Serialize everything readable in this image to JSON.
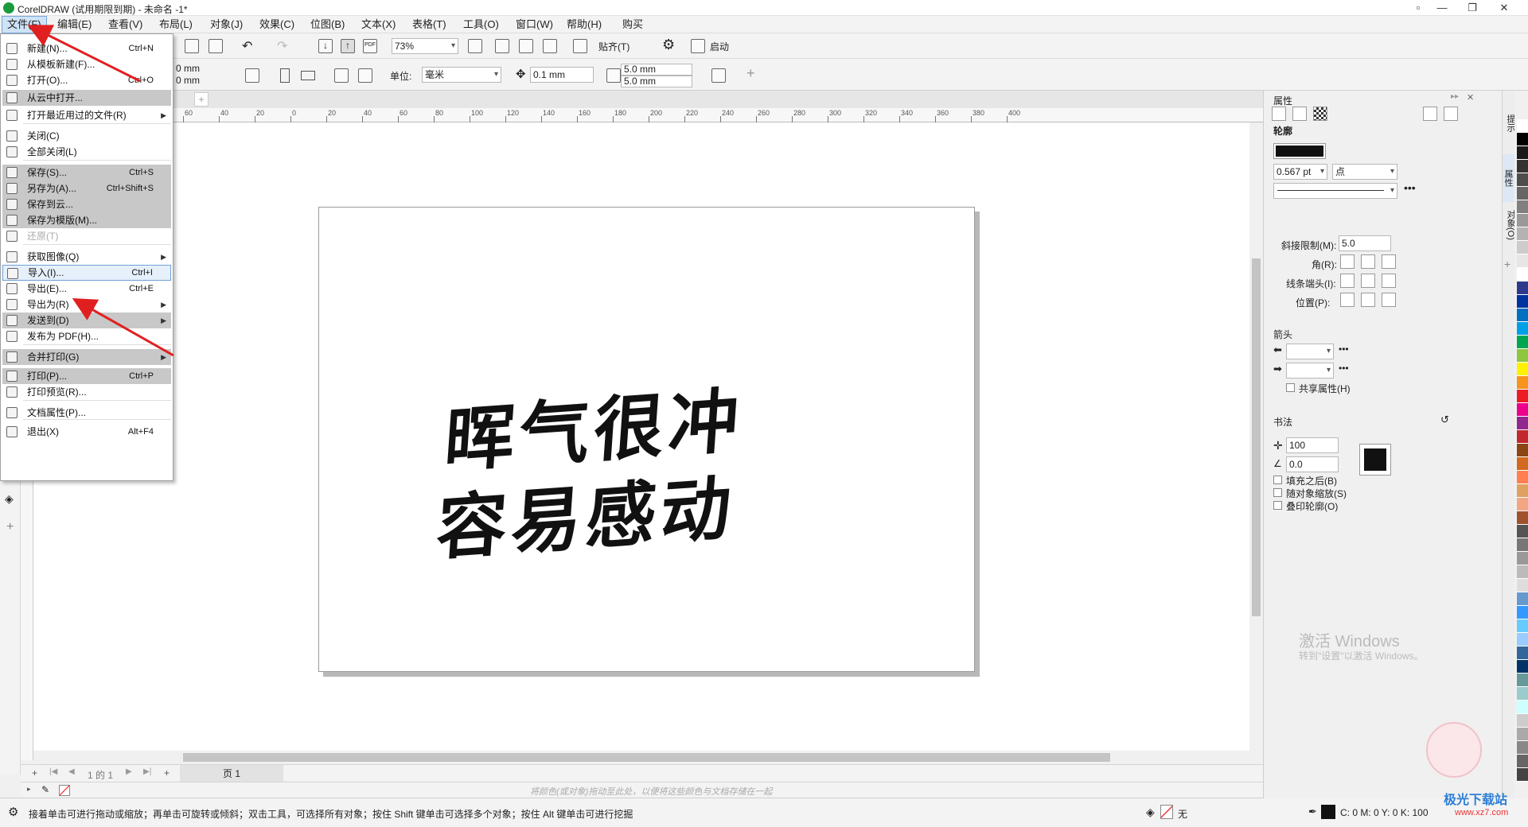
{
  "window": {
    "title": "CorelDRAW (试用期限到期) - 未命名 -1*"
  },
  "menubar": {
    "items": [
      "文件(F)",
      "编辑(E)",
      "查看(V)",
      "布局(L)",
      "对象(J)",
      "效果(C)",
      "位图(B)",
      "文本(X)",
      "表格(T)",
      "工具(O)",
      "窗口(W)",
      "帮助(H)",
      "购买"
    ]
  },
  "toolbar": {
    "zoom": "73%",
    "snap_label": "贴齐(T)",
    "launch_label": "启动",
    "pdf_label": "PDF"
  },
  "propbar": {
    "x": "0 mm",
    "y": "0 mm",
    "unit_label": "单位:",
    "unit_value": "毫米",
    "nudge": "0.1 mm",
    "dup_x": "5.0 mm",
    "dup_y": "5.0 mm"
  },
  "ruler": {
    "ticks": [
      "60",
      "40",
      "20",
      "0",
      "20",
      "40",
      "60",
      "80",
      "100",
      "120",
      "140",
      "160",
      "180",
      "200",
      "220",
      "240",
      "260",
      "280",
      "300",
      "320",
      "340",
      "360",
      "380",
      "400"
    ],
    "units": "毫米"
  },
  "file_menu": {
    "items": [
      {
        "label": "新建(N)...",
        "shortcut": "Ctrl+N"
      },
      {
        "label": "从模板新建(F)...",
        "shortcut": ""
      },
      {
        "label": "打开(O)...",
        "shortcut": "Ctrl+O"
      },
      {
        "label": "从云中打开...",
        "shortcut": ""
      },
      {
        "label": "打开最近用过的文件(R)",
        "shortcut": ""
      },
      {
        "label": "关闭(C)",
        "shortcut": ""
      },
      {
        "label": "全部关闭(L)",
        "shortcut": ""
      },
      {
        "label": "保存(S)...",
        "shortcut": "Ctrl+S"
      },
      {
        "label": "另存为(A)...",
        "shortcut": "Ctrl+Shift+S"
      },
      {
        "label": "保存到云...",
        "shortcut": ""
      },
      {
        "label": "保存为模版(M)...",
        "shortcut": ""
      },
      {
        "label": "还原(T)",
        "shortcut": ""
      },
      {
        "label": "获取图像(Q)",
        "shortcut": ""
      },
      {
        "label": "导入(I)...",
        "shortcut": "Ctrl+I"
      },
      {
        "label": "导出(E)...",
        "shortcut": "Ctrl+E"
      },
      {
        "label": "导出为(R)",
        "shortcut": ""
      },
      {
        "label": "发送到(D)",
        "shortcut": ""
      },
      {
        "label": "发布为 PDF(H)...",
        "shortcut": ""
      },
      {
        "label": "合并打印(G)",
        "shortcut": ""
      },
      {
        "label": "打印(P)...",
        "shortcut": "Ctrl+P"
      },
      {
        "label": "打印预览(R)...",
        "shortcut": ""
      },
      {
        "label": "文档属性(P)...",
        "shortcut": ""
      },
      {
        "label": "退出(X)",
        "shortcut": "Alt+F4"
      }
    ]
  },
  "canvas": {
    "line1": "晖气很冲",
    "line2": "容易感动"
  },
  "pagebar": {
    "page_count": "1 的 1",
    "page_tab": "页 1"
  },
  "colorstrip": {
    "hint": "将颜色(或对象)拖动至此处，以便将这些颜色与文档存储在一起"
  },
  "statusbar": {
    "text": "接着单击可进行拖动或缩放；再单击可旋转或倾斜；双击工具，可选择所有对象；按住 Shift 键单击可选择多个对象；按住 Alt 键单击可进行挖掘",
    "fill_label": "无",
    "cmyk": "C: 0 M: 0 Y: 0 K: 100"
  },
  "props": {
    "title": "属性",
    "outline_title": "轮廓",
    "width": "0.567 pt",
    "width_unit": "点",
    "miter_label": "斜接限制(M):",
    "miter_value": "5.0",
    "corner_label": "角(R):",
    "cap_label": "线条端头(I):",
    "pos_label": "位置(P):",
    "arrow_title": "箭头",
    "share_attr": "共享属性(H)",
    "calligraphy_title": "书法",
    "stretch": "100",
    "angle": "0.0",
    "behind_fill": "填充之后(B)",
    "scale_with": "随对象缩放(S)",
    "overprint": "叠印轮廓(O)"
  },
  "docker_tabs": [
    "提示",
    "属性",
    "对象(O)"
  ],
  "watermark": {
    "line1": "激活 Windows",
    "line2": "转到\"设置\"以激活 Windows。",
    "site": "极光下载站",
    "url": "www.xz7.com"
  },
  "palette_colors": [
    "#ffffff",
    "#000000",
    "#1a1a1a",
    "#333333",
    "#4d4d4d",
    "#666666",
    "#808080",
    "#999999",
    "#b3b3b3",
    "#cccccc",
    "#e6e6e6",
    "#ffffff",
    "#2d3a8c",
    "#0033a0",
    "#0070c0",
    "#00a0e9",
    "#00a651",
    "#8dc63f",
    "#fff200",
    "#f7941d",
    "#ed1c24",
    "#ec008c",
    "#92278f",
    "#c1272d",
    "#8b4513",
    "#d2691e",
    "#ff7f50",
    "#e0a060",
    "#f4a582",
    "#a0522d",
    "#555555",
    "#777777",
    "#999999",
    "#bbbbbb",
    "#dddddd",
    "#6699cc",
    "#3399ff",
    "#66ccff",
    "#99ccff",
    "#336699",
    "#003366",
    "#669999",
    "#99cccc",
    "#ccffff",
    "#cccccc",
    "#aaaaaa",
    "#888888",
    "#666666",
    "#444444"
  ]
}
